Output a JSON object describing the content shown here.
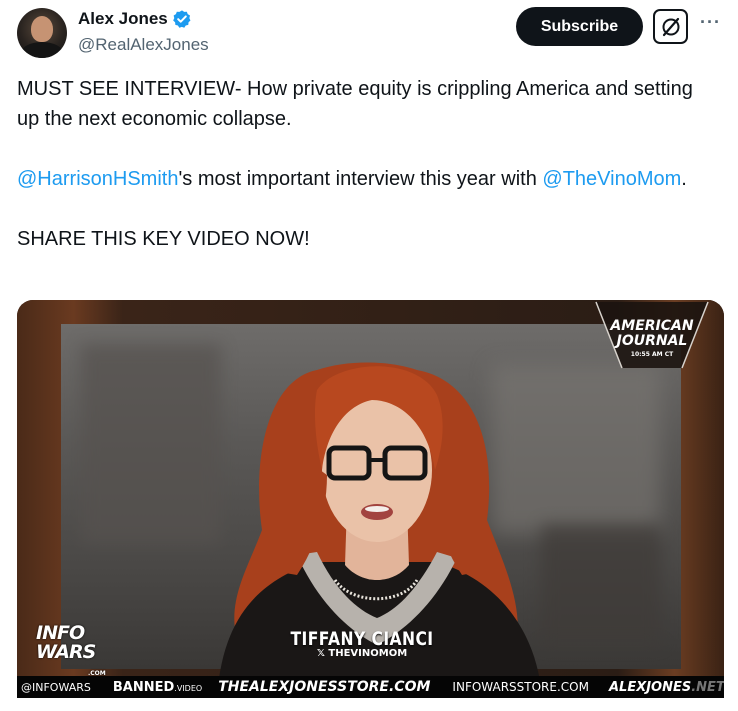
{
  "author": {
    "name": "Alex Jones",
    "handle": "@RealAlexJones",
    "verified": true
  },
  "actions": {
    "subscribe_label": "Subscribe",
    "grok_icon": "grok-icon",
    "more_icon": "more-icon"
  },
  "tweet": {
    "line1": "MUST SEE INTERVIEW- How private equity is crippling America and setting up the next economic collapse.",
    "mention1": "@HarrisonHSmith",
    "mid_text": "'s most important interview this year with ",
    "mention2": "@TheVinoMom",
    "end_text": ".",
    "line3": "SHARE THIS KEY VIDEO NOW!"
  },
  "video": {
    "guest_name": "TIFFANY CIANCI",
    "guest_handle": "THEVINOMOM",
    "show_logo_line1": "AMERICAN",
    "show_logo_line2": "JOURNAL",
    "show_time": "10:55 AM CT",
    "network_line1": "INFO",
    "network_line2": "WARS",
    "network_suffix": ".COM",
    "ticker": {
      "item1": "@INFOWARS",
      "item2": "BANNED",
      "item2_suffix": ".VIDEO",
      "item3": "THEALEXJONESSTORE.COM",
      "item4": "INFOWARSSTORE.COM",
      "item5": "ALEXJONES",
      "item5_suffix": ".NETWO"
    }
  },
  "colors": {
    "accent": "#1d9bf0",
    "text": "#0f1419",
    "muted": "#536471"
  }
}
